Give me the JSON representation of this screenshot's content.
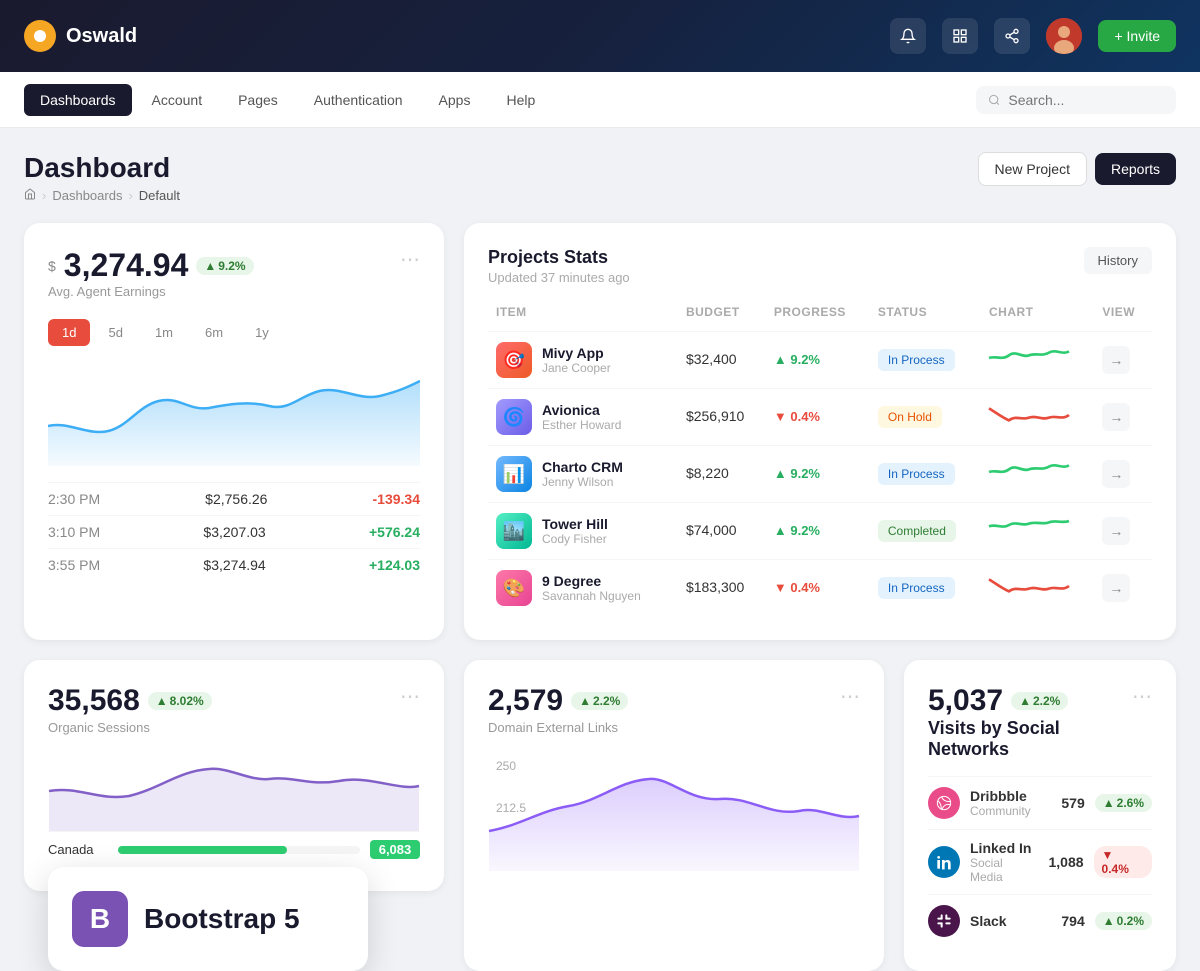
{
  "app": {
    "logo_text": "Oswald",
    "invite_label": "+ Invite"
  },
  "nav": {
    "items": [
      {
        "label": "Dashboards",
        "active": true
      },
      {
        "label": "Account",
        "active": false
      },
      {
        "label": "Pages",
        "active": false
      },
      {
        "label": "Authentication",
        "active": false
      },
      {
        "label": "Apps",
        "active": false
      },
      {
        "label": "Help",
        "active": false
      }
    ],
    "search_placeholder": "Search..."
  },
  "page": {
    "title": "Dashboard",
    "breadcrumbs": [
      "home",
      "Dashboards",
      "Default"
    ],
    "btn_new_project": "New Project",
    "btn_reports": "Reports"
  },
  "earnings": {
    "currency": "$",
    "amount": "3,274.94",
    "badge": "9.2%",
    "subtitle": "Avg. Agent Earnings",
    "time_filters": [
      "1d",
      "5d",
      "1m",
      "6m",
      "1y"
    ],
    "active_filter": "1d",
    "more_icon": "•••",
    "timeline": [
      {
        "time": "2:30 PM",
        "amount": "$2,756.26",
        "delta": "-139.34",
        "type": "neg"
      },
      {
        "time": "3:10 PM",
        "amount": "$3,207.03",
        "delta": "+576.24",
        "type": "pos"
      },
      {
        "time": "3:55 PM",
        "amount": "$3,274.94",
        "delta": "+124.03",
        "type": "pos"
      }
    ]
  },
  "projects": {
    "title": "Projects Stats",
    "subtitle": "Updated 37 minutes ago",
    "history_btn": "History",
    "columns": [
      "ITEM",
      "BUDGET",
      "PROGRESS",
      "STATUS",
      "CHART",
      "VIEW"
    ],
    "rows": [
      {
        "name": "Mivy App",
        "person": "Jane Cooper",
        "budget": "$32,400",
        "progress": "9.2%",
        "progress_up": true,
        "status": "In Process",
        "status_type": "inprocess",
        "icon_color": "#e74c3c",
        "icon_char": "🎯"
      },
      {
        "name": "Avionica",
        "person": "Esther Howard",
        "budget": "$256,910",
        "progress": "0.4%",
        "progress_up": false,
        "status": "On Hold",
        "status_type": "onhold",
        "icon_color": "#9b59b6",
        "icon_char": "🌀"
      },
      {
        "name": "Charto CRM",
        "person": "Jenny Wilson",
        "budget": "$8,220",
        "progress": "9.2%",
        "progress_up": true,
        "status": "In Process",
        "status_type": "inprocess",
        "icon_color": "#3498db",
        "icon_char": "📊"
      },
      {
        "name": "Tower Hill",
        "person": "Cody Fisher",
        "budget": "$74,000",
        "progress": "9.2%",
        "progress_up": true,
        "status": "Completed",
        "status_type": "completed",
        "icon_color": "#1abc9c",
        "icon_char": "🏙️"
      },
      {
        "name": "9 Degree",
        "person": "Savannah Nguyen",
        "budget": "$183,300",
        "progress": "0.4%",
        "progress_up": false,
        "status": "In Process",
        "status_type": "inprocess",
        "icon_color": "#e74c3c",
        "icon_char": "🎨"
      }
    ]
  },
  "organic_sessions": {
    "value": "35,568",
    "badge": "8.02%",
    "label": "Organic Sessions"
  },
  "domain_links": {
    "value": "2,579",
    "badge": "2.2%",
    "label": "Domain External Links"
  },
  "social_networks": {
    "title": "Visits by Social Networks",
    "value": "5,037",
    "badge": "2.2%",
    "networks": [
      {
        "name": "Dribbble",
        "sub": "Community",
        "count": "579",
        "badge": "2.6%",
        "badge_up": true,
        "color": "#ea4c89"
      },
      {
        "name": "Linked In",
        "sub": "Social Media",
        "count": "1,088",
        "badge": "0.4%",
        "badge_up": false,
        "color": "#0077b5"
      },
      {
        "name": "Slack",
        "sub": "",
        "count": "794",
        "badge": "0.2%",
        "badge_up": true,
        "color": "#4a154b"
      }
    ]
  },
  "bootstrap": {
    "icon": "B",
    "text": "Bootstrap 5"
  },
  "canada": {
    "label": "Canada",
    "value": "6,083",
    "bar_pct": 70
  }
}
